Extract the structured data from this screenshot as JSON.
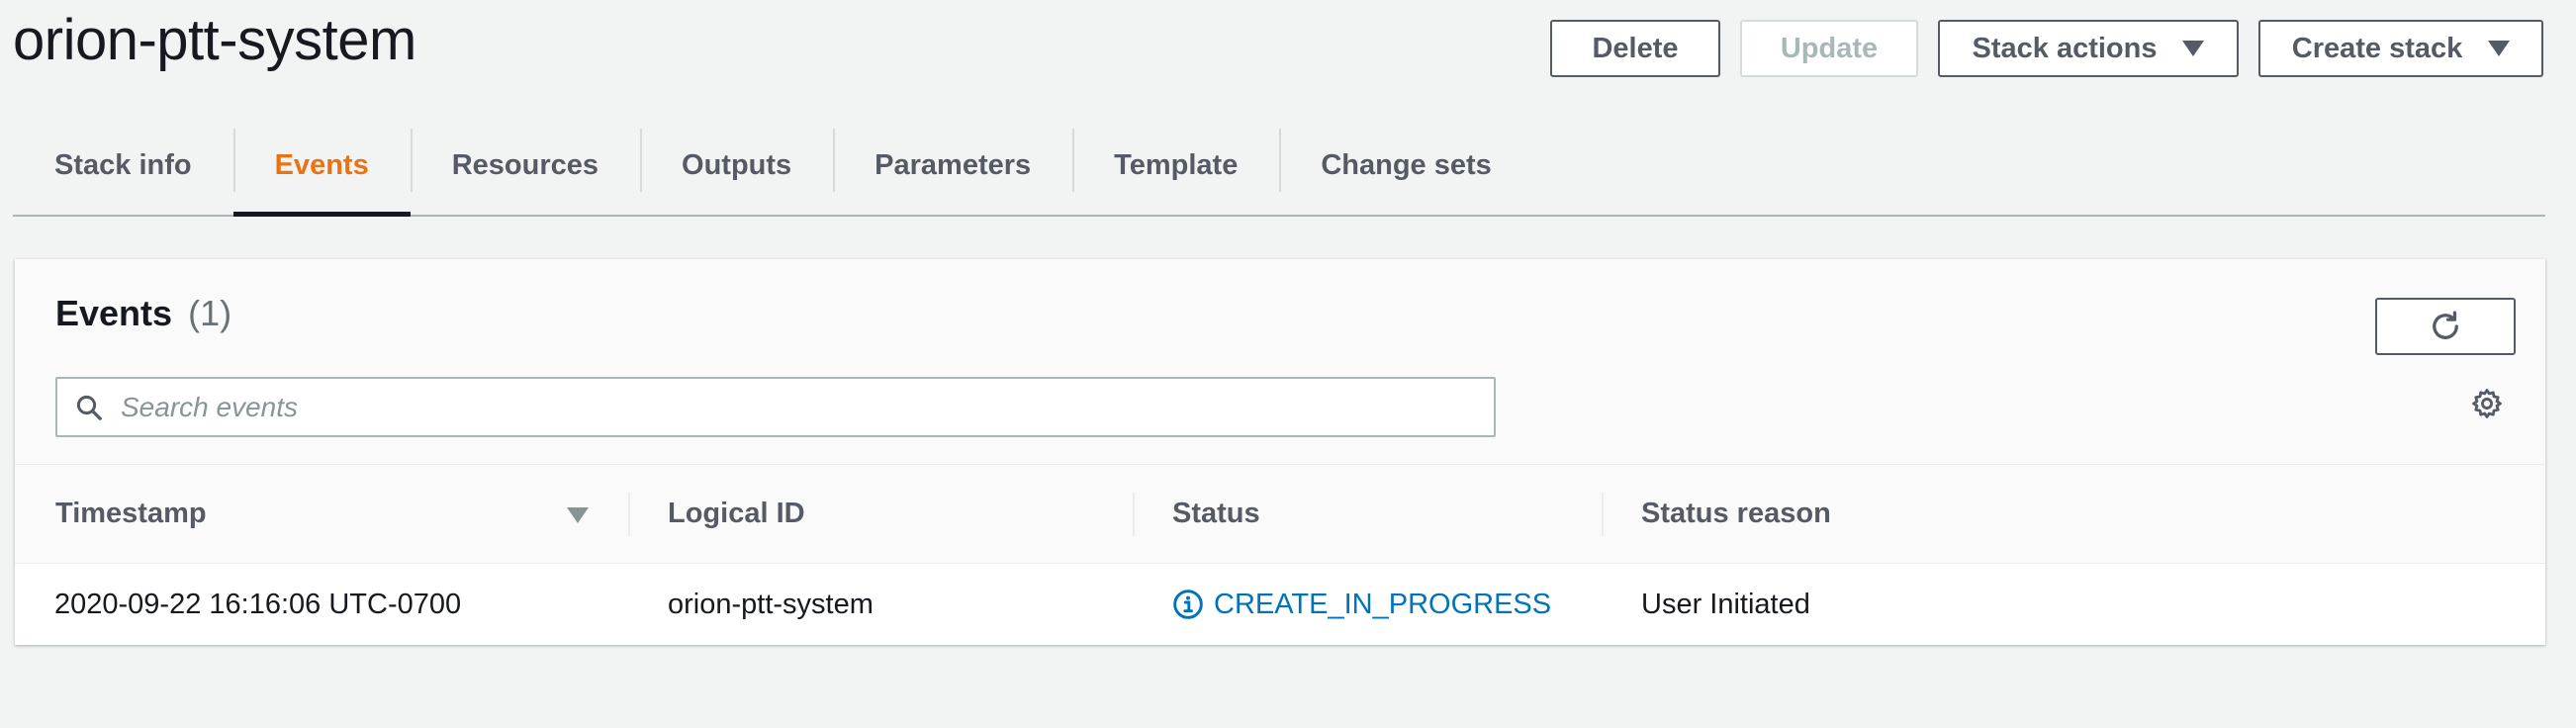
{
  "header": {
    "title": "orion-ptt-system",
    "buttons": {
      "delete": "Delete",
      "update": "Update",
      "stack_actions": "Stack actions",
      "create_stack": "Create stack"
    }
  },
  "tabs": [
    {
      "label": "Stack info",
      "active": false
    },
    {
      "label": "Events",
      "active": true
    },
    {
      "label": "Resources",
      "active": false
    },
    {
      "label": "Outputs",
      "active": false
    },
    {
      "label": "Parameters",
      "active": false
    },
    {
      "label": "Template",
      "active": false
    },
    {
      "label": "Change sets",
      "active": false
    }
  ],
  "events": {
    "title": "Events",
    "count": "(1)",
    "search": {
      "placeholder": "Search events",
      "value": ""
    },
    "columns": [
      "Timestamp",
      "Logical ID",
      "Status",
      "Status reason"
    ],
    "rows": [
      {
        "timestamp": "2020-09-22 16:16:06 UTC-0700",
        "logical_id": "orion-ptt-system",
        "status": "CREATE_IN_PROGRESS",
        "status_reason": "User Initiated"
      }
    ]
  },
  "colors": {
    "active_tab": "#ec7211",
    "status_link": "#0073bb",
    "background": "#f2f3f3"
  },
  "icons": {
    "refresh": "refresh-icon",
    "search": "search-icon",
    "settings": "gear-icon",
    "status": "info-icon",
    "sort": "sort-desc-icon",
    "dropdown": "caret-down-icon"
  }
}
